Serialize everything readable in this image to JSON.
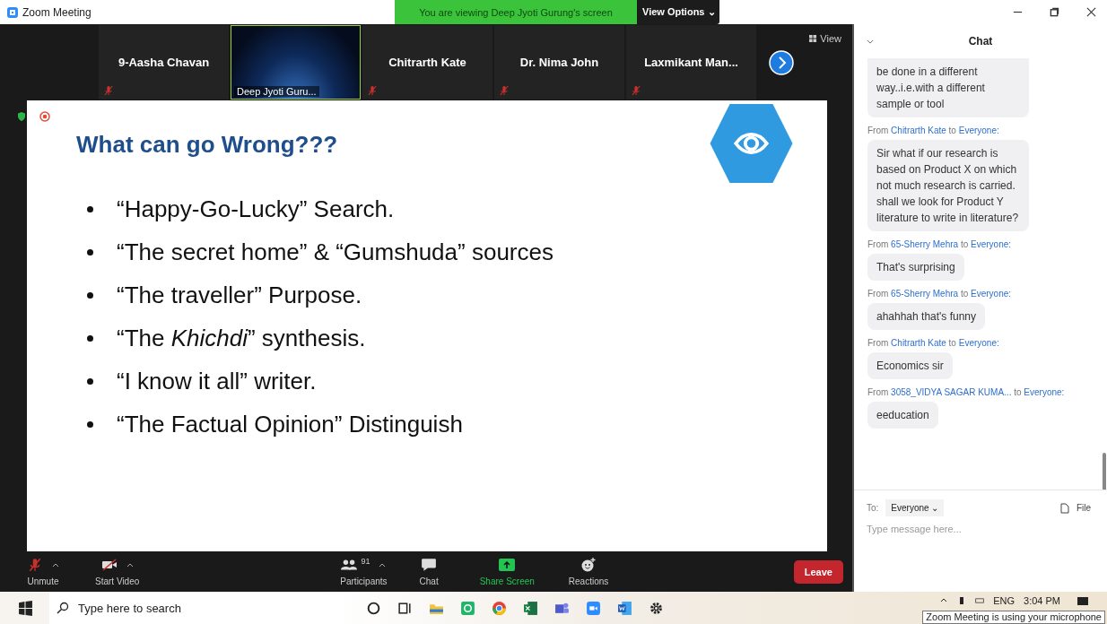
{
  "window": {
    "title": "Zoom Meeting"
  },
  "share_banner": {
    "text": "You are viewing Deep Jyoti Gurung's screen",
    "options": "View Options ⌄"
  },
  "gallery": {
    "view_label": "View",
    "tiles": [
      {
        "kind": "name",
        "name": "9-Aasha Chavan",
        "muted": true
      },
      {
        "kind": "video",
        "name": "Deep Jyoti Guru...",
        "muted": false
      },
      {
        "kind": "name",
        "name": "Chitrarth Kate",
        "muted": true
      },
      {
        "kind": "name",
        "name": "Dr. Nima John",
        "muted": true
      },
      {
        "kind": "name",
        "name": "Laxmikant  Man...",
        "muted": true
      }
    ]
  },
  "slide": {
    "title": "What can go Wrong???",
    "bullets": [
      "“Happy-Go-Lucky” Search.",
      "“The secret home”  & “Gumshuda” sources",
      "“The traveller” Purpose.",
      "“The *Khichdi*” synthesis.",
      "“I know it all” writer.",
      "“The Factual Opinion” Distinguish"
    ]
  },
  "toolbar": {
    "items": [
      {
        "kind": "mic",
        "label": "Unmute"
      },
      {
        "kind": "video",
        "label": "Start Video"
      },
      {
        "kind": "participants",
        "label": "Participants",
        "count": "91"
      },
      {
        "kind": "chat",
        "label": "Chat"
      },
      {
        "kind": "share",
        "label": "Share Screen"
      },
      {
        "kind": "reactions",
        "label": "Reactions"
      }
    ],
    "leave": "Leave"
  },
  "chat": {
    "title": "Chat",
    "messages": [
      {
        "text": "be done in a different way..i.e.with a different sample or tool"
      },
      {
        "from_word": "From",
        "sender": "Chitrarth Kate",
        "to_word": "to",
        "recipient": "Everyone:",
        "text": "Sir what if our research is based on Product X on which not much research is carried. shall we look for Product Y literature to write in literature?"
      },
      {
        "from_word": "From",
        "sender": "65-Sherry Mehra",
        "to_word": "to",
        "recipient": "Everyone:",
        "text": "That's surprising"
      },
      {
        "from_word": "From",
        "sender": "65-Sherry Mehra",
        "to_word": "to",
        "recipient": "Everyone:",
        "text": "ahahhah that's funny"
      },
      {
        "from_word": "From",
        "sender": "Chitrarth Kate",
        "to_word": "to",
        "recipient": "Everyone:",
        "text": "Economics sir"
      },
      {
        "from_word": "From",
        "sender": "3058_VIDYA SAGAR KUMA...",
        "to_word": "to",
        "recipient": "Everyone:",
        "text": "eeducation"
      }
    ],
    "to_label": "To:",
    "recipient": "Everyone ⌄",
    "file_label": "File",
    "placeholder": "Type message here..."
  },
  "taskbar": {
    "search_placeholder": "Type here to search",
    "language": "ENG",
    "time": "3:04 PM",
    "tooltip": "Zoom Meeting is using your microphone"
  }
}
